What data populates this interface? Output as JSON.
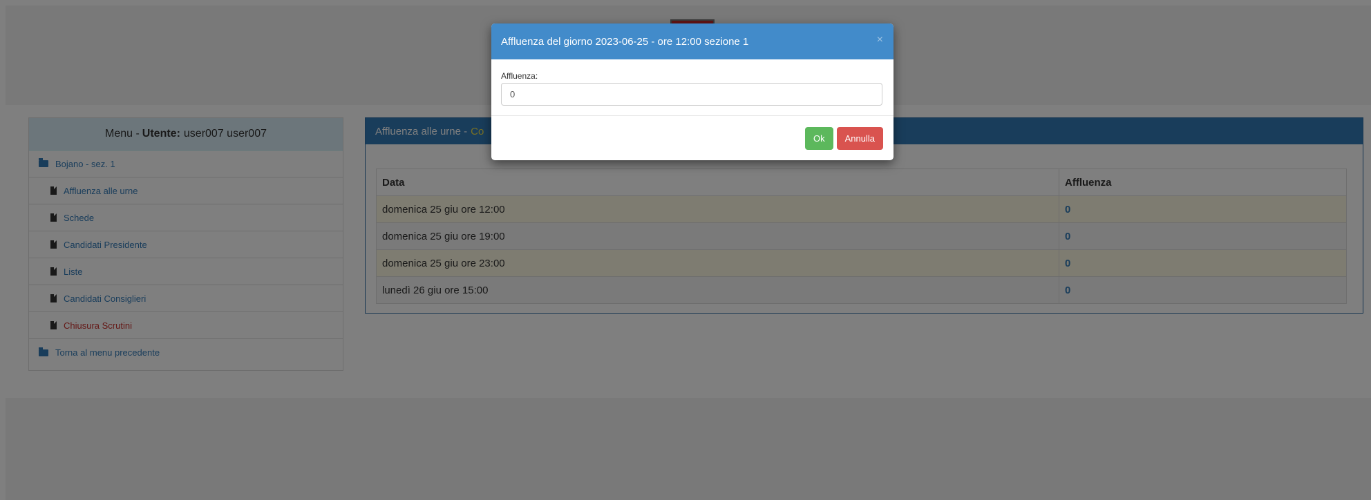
{
  "sidebar": {
    "menu_prefix": "Menu -",
    "user_label": "Utente:",
    "user_name": "user007 user007",
    "items": [
      {
        "label": "Bojano - sez. 1"
      },
      {
        "label": "Affluenza alle urne"
      },
      {
        "label": "Schede"
      },
      {
        "label": "Candidati Presidente"
      },
      {
        "label": "Liste"
      },
      {
        "label": "Candidati Consiglieri"
      },
      {
        "label": "Chiusura Scrutini"
      },
      {
        "label": "Torna al menu precedente"
      }
    ]
  },
  "main": {
    "title": "Affluenza alle urne -",
    "title_accent": "Co",
    "table": {
      "headers": [
        "Data",
        "Affluenza"
      ],
      "rows": [
        {
          "date": "domenica 25 giu ore 12:00",
          "value": "0"
        },
        {
          "date": "domenica 25 giu ore 19:00",
          "value": "0"
        },
        {
          "date": "domenica 25 giu ore 23:00",
          "value": "0"
        },
        {
          "date": "lunedì 26 giu ore 15:00",
          "value": "0"
        }
      ]
    }
  },
  "modal": {
    "title": "Affluenza del giorno 2023-06-25 - ore 12:00 sezione 1",
    "close": "×",
    "field_label": "Affluenza:",
    "field_value": "0",
    "ok_label": "Ok",
    "cancel_label": "Annulla"
  },
  "colors": {
    "primary": "#337ab7",
    "modal_header": "#428bca",
    "success": "#5cb85c",
    "danger": "#d9534f"
  }
}
